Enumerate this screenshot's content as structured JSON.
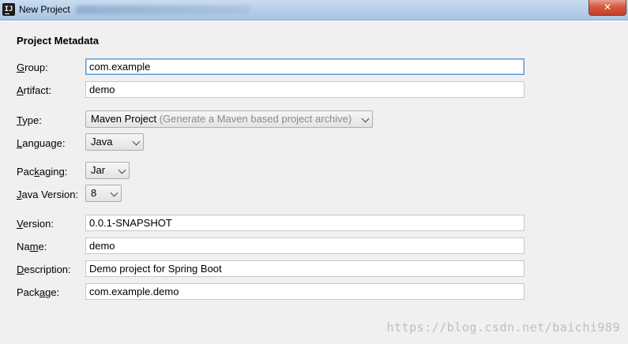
{
  "window": {
    "title": "New Project",
    "close_glyph": "✕"
  },
  "app_icon": {
    "glyph": "IJ"
  },
  "section_title": "Project Metadata",
  "form": {
    "group": {
      "label": "Group:",
      "mnemonic": "G",
      "rest": "roup:",
      "value": "com.example"
    },
    "artifact": {
      "label": "Artifact:",
      "mnemonic": "A",
      "rest": "rtifact:",
      "value": "demo"
    },
    "type": {
      "label": "Type:",
      "mnemonic": "T",
      "rest": "ype:",
      "value": "Maven Project",
      "hint": "(Generate a Maven based project archive)"
    },
    "language": {
      "label": "Language:",
      "mnemonic": "L",
      "rest": "anguage:",
      "value": "Java"
    },
    "packaging": {
      "label": "Packaging:",
      "pre": "Pac",
      "mnemonic": "k",
      "rest": "aging:",
      "value": "Jar"
    },
    "java_version": {
      "label": "Java Version:",
      "mnemonic": "J",
      "rest": "ava Version:",
      "value": "8"
    },
    "version": {
      "label": "Version:",
      "mnemonic": "V",
      "rest": "ersion:",
      "value": "0.0.1-SNAPSHOT"
    },
    "name": {
      "label": "Name:",
      "pre": "Na",
      "mnemonic": "m",
      "rest": "e:",
      "value": "demo"
    },
    "description": {
      "label": "Description:",
      "mnemonic": "D",
      "rest": "escription:",
      "value": "Demo project for Spring Boot"
    },
    "package": {
      "label": "Package:",
      "pre": "Pack",
      "mnemonic": "a",
      "rest": "ge:",
      "value": "com.example.demo"
    }
  },
  "watermark": "https://blog.csdn.net/baichi989"
}
